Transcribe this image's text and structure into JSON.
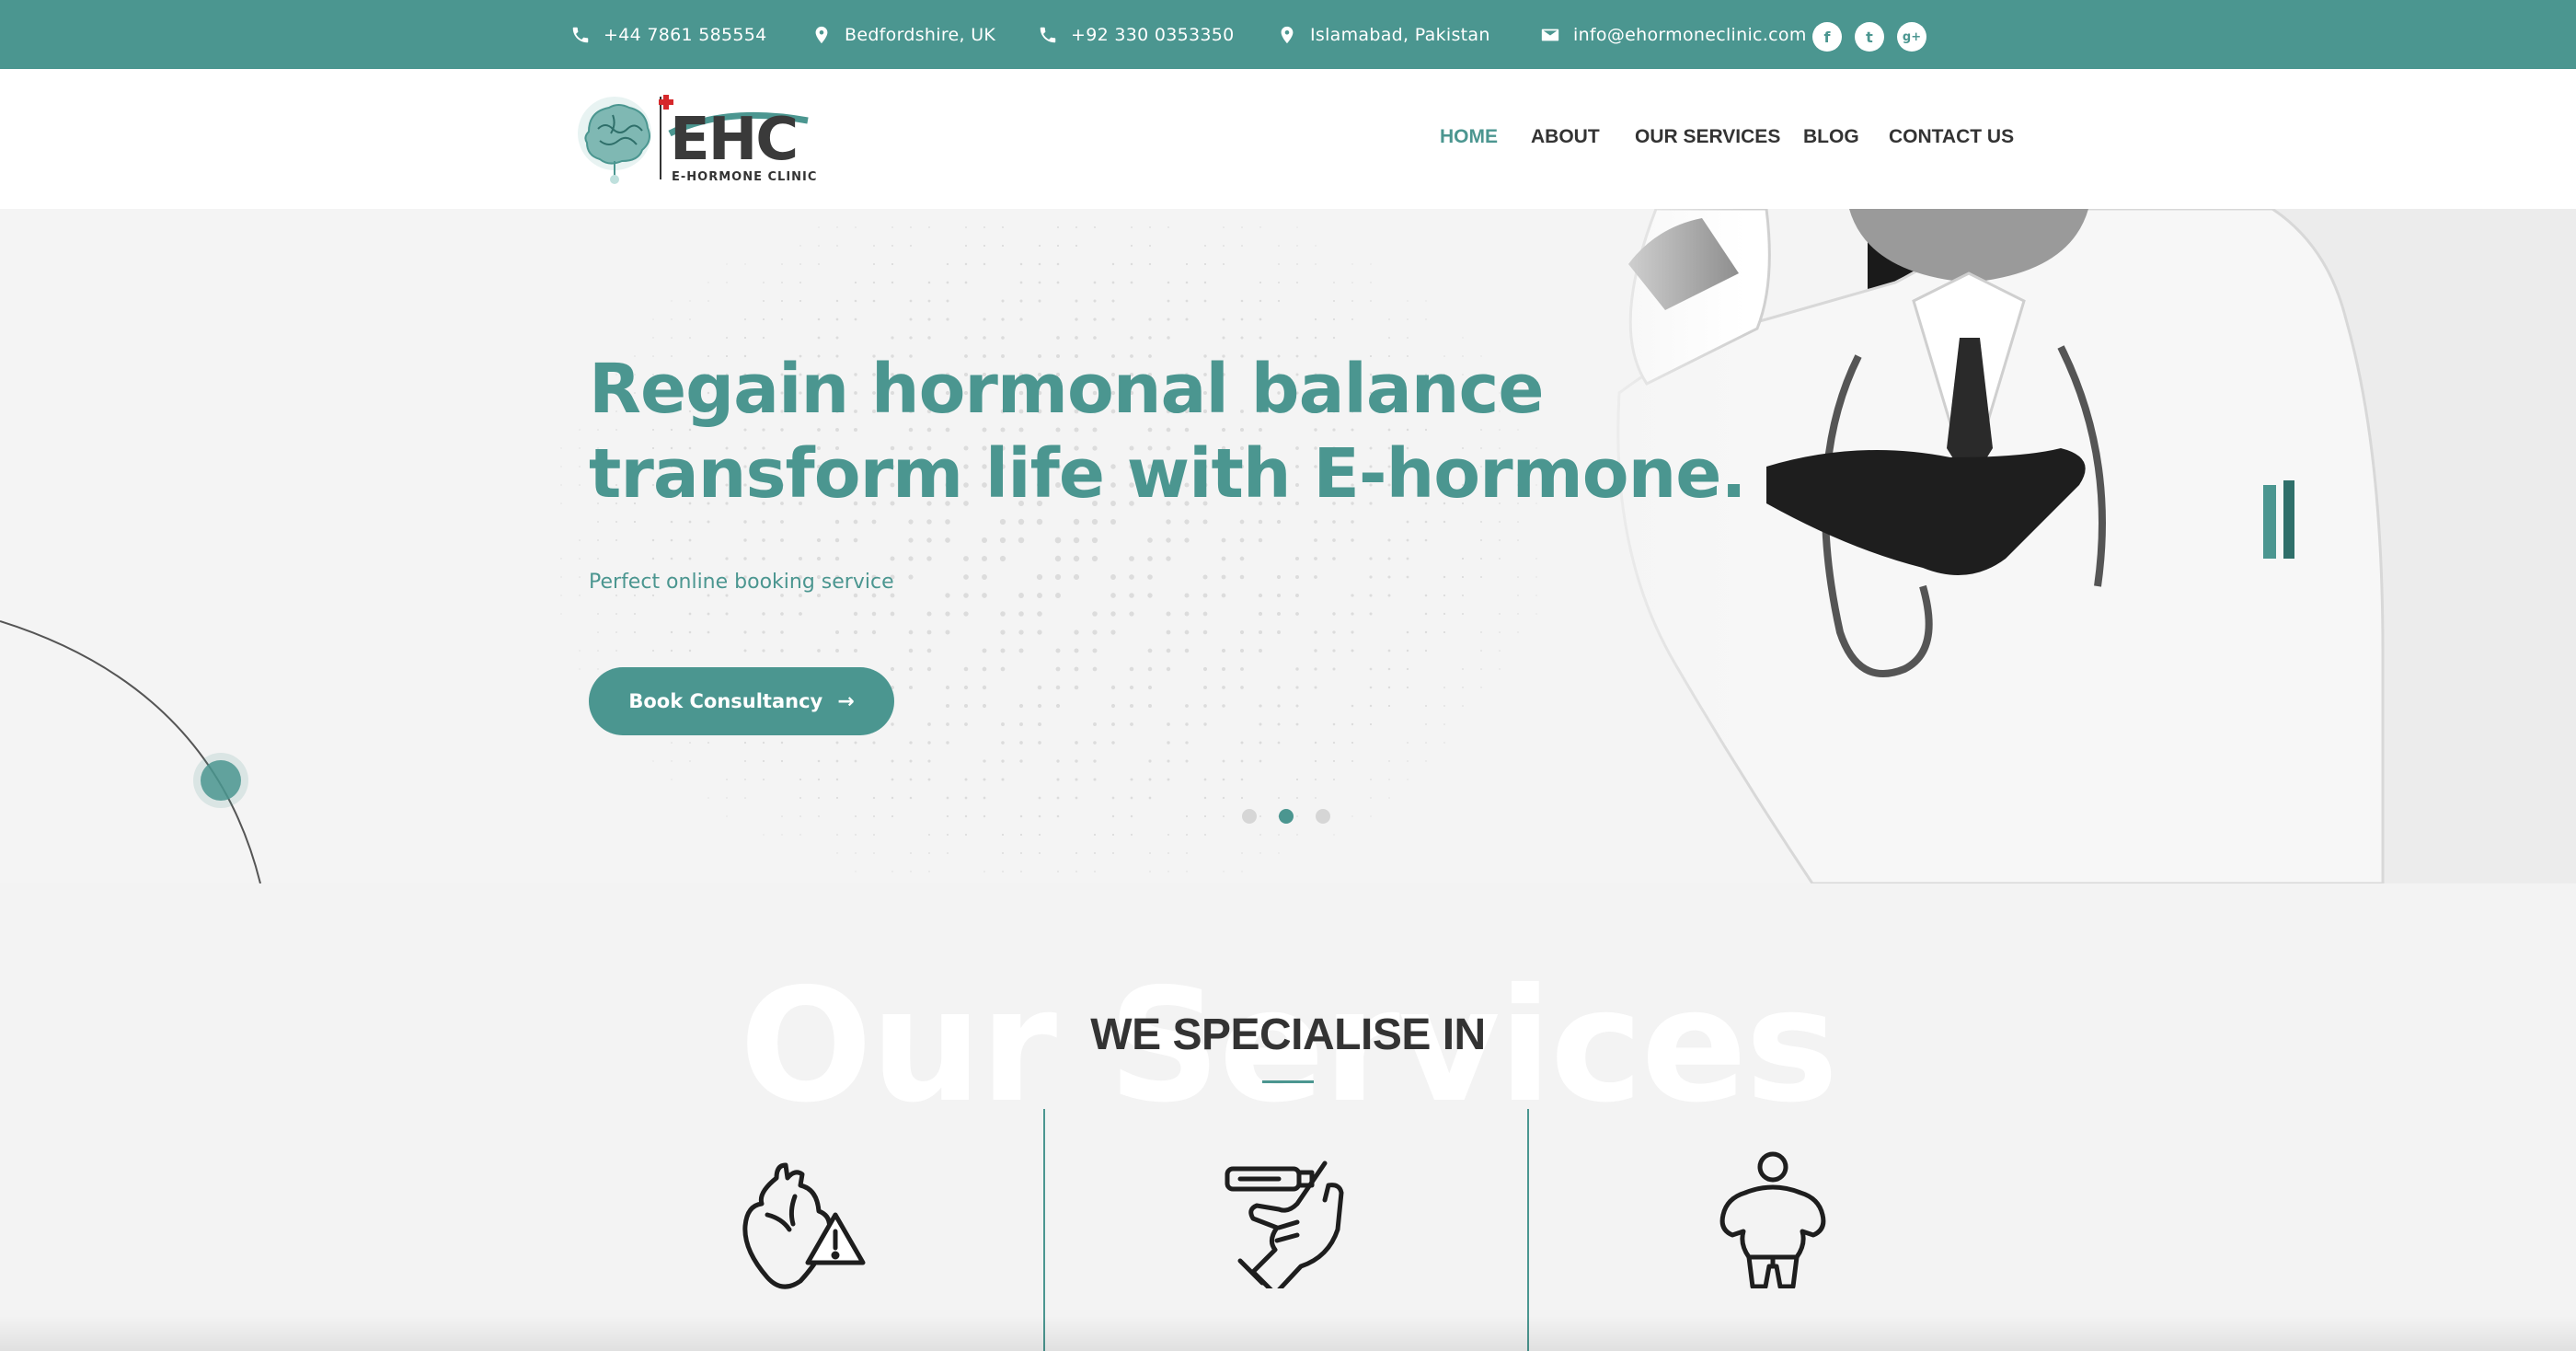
{
  "topbar": {
    "contacts": [
      {
        "icon": "phone-icon",
        "text": "+44 7861 585554"
      },
      {
        "icon": "location-pin-icon",
        "text": "Bedfordshire, UK"
      },
      {
        "icon": "phone-icon",
        "text": "+92 330 0353350"
      },
      {
        "icon": "location-pin-icon",
        "text": "Islamabad, Pakistan"
      },
      {
        "icon": "mail-icon",
        "text": "info@ehormoneclinic.com"
      }
    ],
    "social": [
      {
        "icon": "facebook-icon",
        "glyph": "f"
      },
      {
        "icon": "twitter-icon",
        "glyph": "t"
      },
      {
        "icon": "google-plus-icon",
        "glyph": "g+"
      }
    ]
  },
  "header": {
    "logo": {
      "wordmark": "EHC",
      "tagline": "E-HORMONE CLINIC"
    },
    "nav": [
      {
        "label": "HOME",
        "active": true
      },
      {
        "label": "ABOUT",
        "active": false
      },
      {
        "label": "OUR SERVICES",
        "active": false
      },
      {
        "label": "BLOG",
        "active": false
      },
      {
        "label": "CONTACT US",
        "active": false
      }
    ]
  },
  "hero": {
    "title_line1": "Regain hormonal balance",
    "title_line2": "transform life with E-hormone.",
    "subtitle": "Perfect online booking service",
    "cta_label": "Book Consultancy",
    "cta_icon": "arrow-right-icon",
    "slides_total": 3,
    "active_slide": 2
  },
  "services": {
    "background_word": "Our Services",
    "title": "WE SPECIALISE IN",
    "items": [
      {
        "icon": "heart-warning-icon"
      },
      {
        "icon": "hand-thermometer-icon"
      },
      {
        "icon": "obesity-person-icon"
      }
    ]
  },
  "colors": {
    "accent": "#4b9690",
    "text_dark": "#333333",
    "hero_bg": "#f4f4f4"
  }
}
